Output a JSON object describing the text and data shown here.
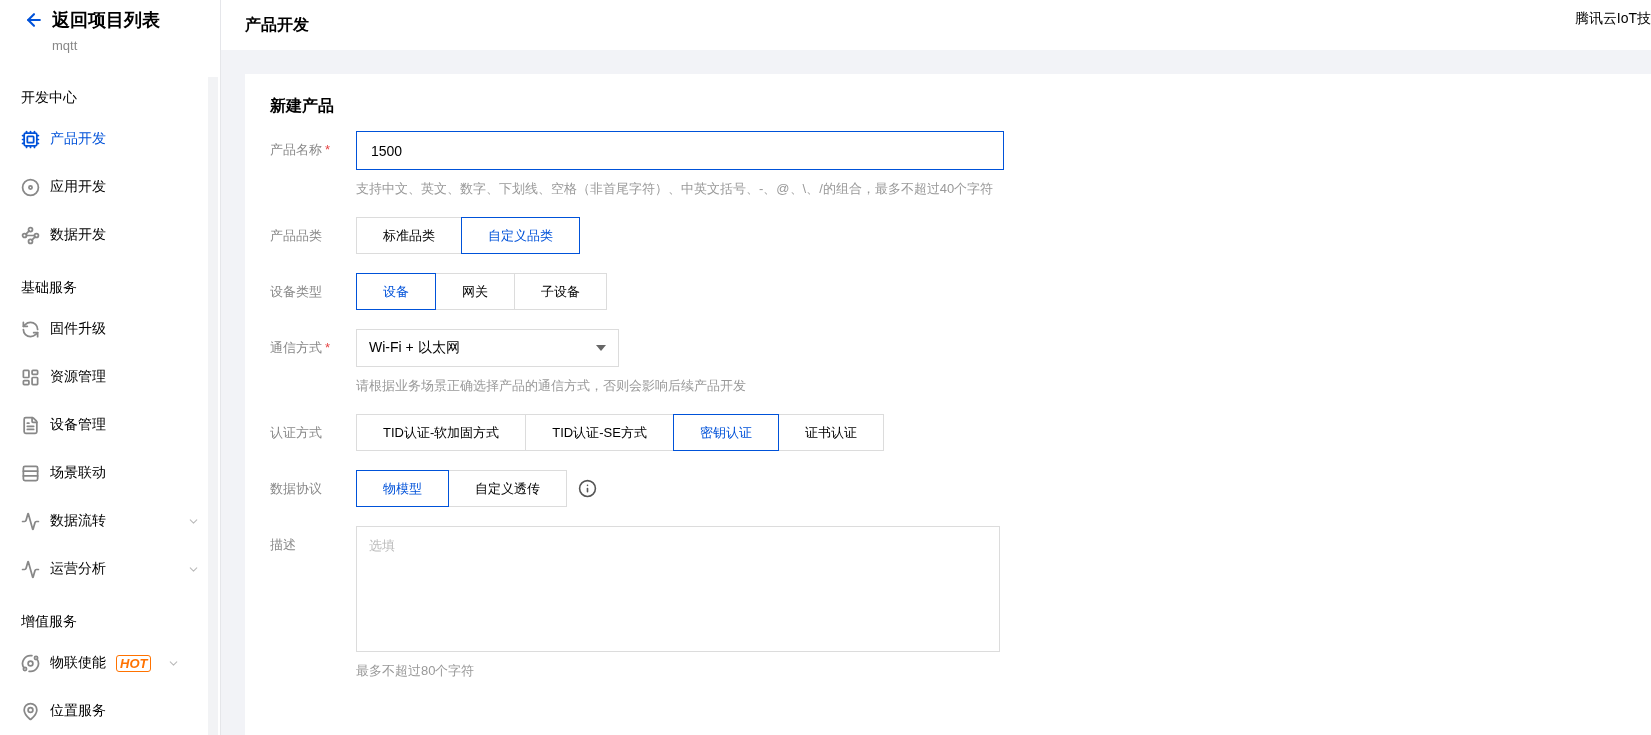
{
  "sidebar": {
    "back": {
      "label": "返回项目列表",
      "sub": "mqtt"
    },
    "sections": [
      {
        "title": "开发中心",
        "items": [
          {
            "label": "产品开发",
            "selected": true
          },
          {
            "label": "应用开发",
            "selected": false
          },
          {
            "label": "数据开发",
            "selected": false
          }
        ]
      },
      {
        "title": "基础服务",
        "items": [
          {
            "label": "固件升级",
            "selected": false
          },
          {
            "label": "资源管理",
            "selected": false
          },
          {
            "label": "设备管理",
            "selected": false
          },
          {
            "label": "场景联动",
            "selected": false
          },
          {
            "label": "数据流转",
            "selected": false,
            "expandable": true
          },
          {
            "label": "运营分析",
            "selected": false,
            "expandable": true
          }
        ]
      },
      {
        "title": "增值服务",
        "items": [
          {
            "label": "物联使能",
            "selected": false,
            "expandable": true,
            "badge": "HOT"
          },
          {
            "label": "位置服务",
            "selected": false
          }
        ]
      }
    ]
  },
  "header": {
    "title": "产品开发",
    "right": "腾讯云IoT技"
  },
  "form": {
    "title": "新建产品",
    "fields": [
      {
        "kind": "text",
        "label": "产品名称",
        "required_mark": "*",
        "value": "1500",
        "hint": "支持中文、英文、数字、下划线、空格（非首尾字符）、中英文括号、-、@、\\、/的组合，最多不超过40个字符"
      },
      {
        "kind": "segmented",
        "label": "产品品类",
        "options": [
          {
            "label": "标准品类",
            "selected": false
          },
          {
            "label": "自定义品类",
            "selected": true
          }
        ]
      },
      {
        "kind": "segmented",
        "label": "设备类型",
        "options": [
          {
            "label": "设备",
            "selected": true
          },
          {
            "label": "网关",
            "selected": false
          },
          {
            "label": "子设备",
            "selected": false
          }
        ]
      },
      {
        "kind": "select",
        "label": "通信方式",
        "required_mark": "*",
        "value": "Wi-Fi + 以太网",
        "hint": "请根据业务场景正确选择产品的通信方式，否则会影响后续产品开发"
      },
      {
        "kind": "segmented",
        "label": "认证方式",
        "options": [
          {
            "label": "TID认证-软加固方式",
            "selected": false
          },
          {
            "label": "TID认证-SE方式",
            "selected": false
          },
          {
            "label": "密钥认证",
            "selected": true
          },
          {
            "label": "证书认证",
            "selected": false
          }
        ]
      },
      {
        "kind": "segmented",
        "label": "数据协议",
        "info": true,
        "options": [
          {
            "label": "物模型",
            "selected": true
          },
          {
            "label": "自定义透传",
            "selected": false
          }
        ]
      },
      {
        "kind": "textarea",
        "label": "描述",
        "placeholder": "选填",
        "hint": "最多不超过80个字符"
      }
    ]
  }
}
